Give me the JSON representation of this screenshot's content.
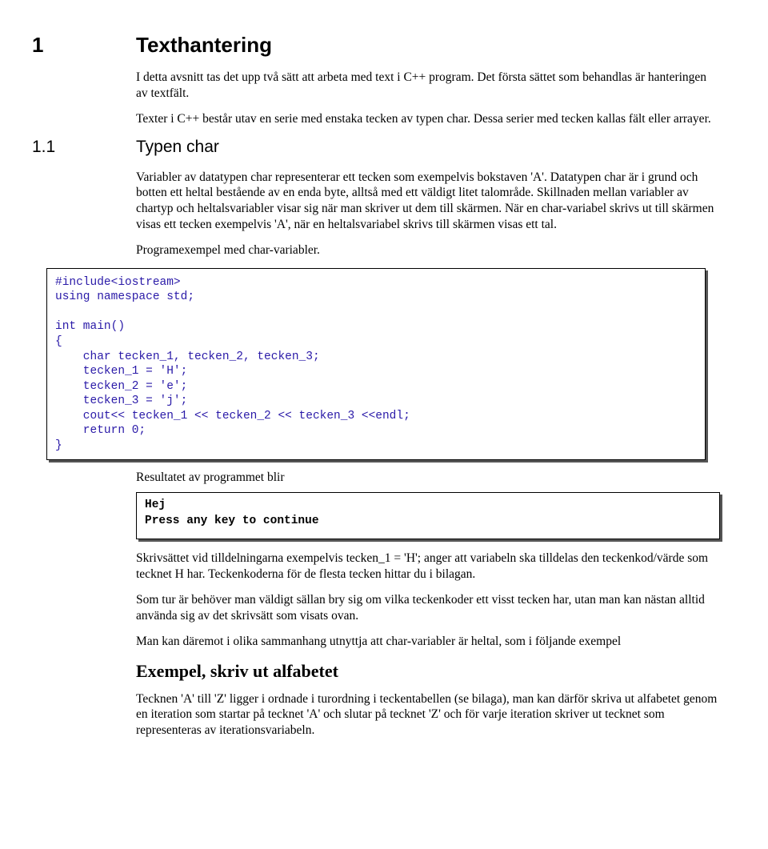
{
  "h1": {
    "num": "1",
    "title": "Texthantering"
  },
  "p1": "I detta avsnitt tas det upp två sätt att arbeta med text i C++ program. Det första sättet som behandlas är hanteringen av textfält.",
  "p2": "Texter i C++ består utav en serie med enstaka tecken av typen char. Dessa serier med tecken kallas fält eller arrayer.",
  "h2": {
    "num": "1.1",
    "title": "Typen char"
  },
  "p3": "Variabler av datatypen char representerar ett tecken som exempelvis bokstaven 'A'. Datatypen char är i grund och botten ett heltal bestående av en enda byte, alltså med ett väldigt litet talområde. Skillnaden mellan variabler av chartyp och heltalsvariabler visar sig när man skriver ut dem till skärmen. När en char-variabel skrivs ut till skärmen visas ett tecken exempelvis 'A', när en heltalsvariabel skrivs till skärmen visas ett tal.",
  "p4": "Programexempel med char-variabler.",
  "code1": "#include<iostream>\nusing namespace std;\n\nint main()\n{\n    char tecken_1, tecken_2, tecken_3;\n    tecken_1 = 'H';\n    tecken_2 = 'e';\n    tecken_3 = 'j';\n    cout<< tecken_1 << tecken_2 << tecken_3 <<endl;\n    return 0;\n}",
  "p5": "Resultatet av programmet blir",
  "output1": "Hej\nPress any key to continue",
  "p6": "Skrivsättet vid tilldelningarna exempelvis tecken_1 = 'H'; anger att variabeln ska tilldelas den teckenkod/värde som tecknet H har. Teckenkoderna för de flesta tecken hittar du i bilagan.",
  "p7": "Som tur är behöver man väldigt sällan bry sig om vilka teckenkoder ett visst tecken har, utan man kan nästan alltid använda sig av det skrivsätt som visats ovan.",
  "p8": "Man kan däremot i olika sammanhang utnyttja att char-variabler är heltal, som i följande exempel",
  "h3": "Exempel, skriv ut alfabetet",
  "p9": "Tecknen 'A' till 'Z' ligger i ordnade i turordning i teckentabellen (se bilaga), man kan därför skriva ut alfabetet genom en iteration som startar på tecknet 'A' och slutar på tecknet 'Z' och för varje iteration skriver ut tecknet som representeras av iterationsvariabeln."
}
